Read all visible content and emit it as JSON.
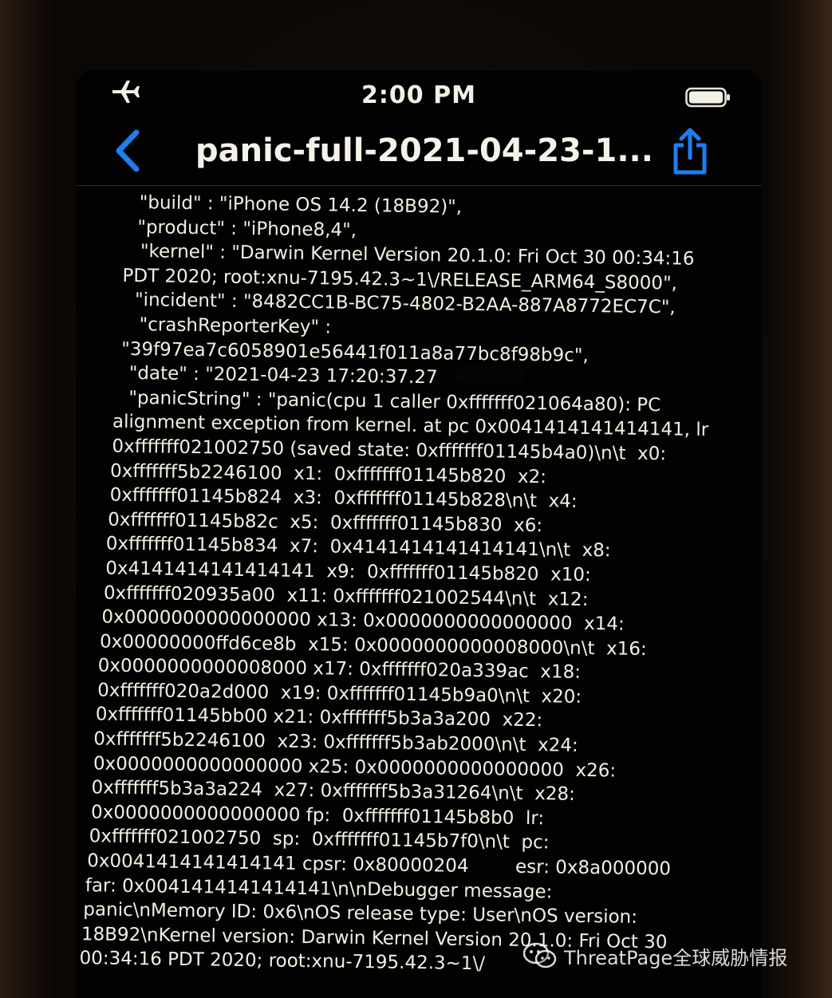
{
  "status_bar": {
    "time": "2:00 PM"
  },
  "nav": {
    "title": "panic-full-2021-04-23-1..."
  },
  "log_lines": [
    "\"build\" : \"iPhone OS 14.2 (18B92)\",",
    "\"product\" : \"iPhone8,4\",",
    "\"kernel\" : \"Darwin Kernel Version 20.1.0: Fri Oct 30 00:34:16",
    "PDT 2020; root:xnu-7195.42.3~1\\/RELEASE_ARM64_S8000\",",
    "\"incident\" : \"8482CC1B-BC75-4802-B2AA-887A8772EC7C\",",
    "\"crashReporterKey\" :",
    "\"39f97ea7c6058901e56441f011a8a77bc8f98b9c\",",
    "\"date\" : \"2021-04-23 17:20:37.27",
    "\"panicString\" : \"panic(cpu 1 caller 0xfffffff021064a80): PC",
    "alignment exception from kernel. at pc 0x0041414141414141, lr",
    "0xfffffff021002750 (saved state: 0xfffffff01145b4a0)\\n\\t  x0:",
    "0xfffffff5b2246100  x1:  0xfffffff01145b820  x2:",
    "0xfffffff01145b824  x3:  0xfffffff01145b828\\n\\t  x4:",
    "0xfffffff01145b82c  x5:  0xfffffff01145b830  x6:",
    "0xfffffff01145b834  x7:  0x4141414141414141\\n\\t  x8:",
    "0x4141414141414141  x9:  0xfffffff01145b820  x10:",
    "0xfffffff020935a00  x11: 0xfffffff021002544\\n\\t  x12:",
    "0x0000000000000000 x13: 0x0000000000000000  x14:",
    "0x00000000ffd6ce8b  x15: 0x0000000000008000\\n\\t  x16:",
    "0x0000000000008000 x17: 0xfffffff020a339ac  x18:",
    "0xfffffff020a2d000  x19: 0xfffffff01145b9a0\\n\\t  x20:",
    "0xfffffff01145bb00 x21: 0xfffffff5b3a3a200  x22:",
    "0xfffffff5b2246100  x23: 0xfffffff5b3ab2000\\n\\t  x24:",
    "0x0000000000000000 x25: 0x0000000000000000  x26:",
    "0xfffffff5b3a3a224  x27: 0xfffffff5b3a31264\\n\\t  x28:",
    "0x0000000000000000 fp:  0xfffffff01145b8b0  lr:",
    "0xfffffff021002750  sp:  0xfffffff01145b7f0\\n\\t  pc:",
    "0x0041414141414141 cpsr: 0x80000204        esr: 0x8a000000",
    "far: 0x0041414141414141\\n\\nDebugger message:",
    "panic\\nMemory ID: 0x6\\nOS release type: User\\nOS version:",
    "18B92\\nKernel version: Darwin Kernel Version 20.1.0: Fri Oct 30",
    "00:34:16 PDT 2020; root:xnu-7195.42.3~1\\/"
  ],
  "watermark": {
    "text": "ThreatPage全球威胁情报"
  },
  "icons": {
    "airplane": "airplane-icon",
    "battery": "battery-icon",
    "back": "chevron-left-icon",
    "share": "share-icon",
    "wechat": "wechat-icon"
  },
  "colors": {
    "accent": "#1e7ef0",
    "text": "#f2efe2",
    "background": "#020202"
  }
}
